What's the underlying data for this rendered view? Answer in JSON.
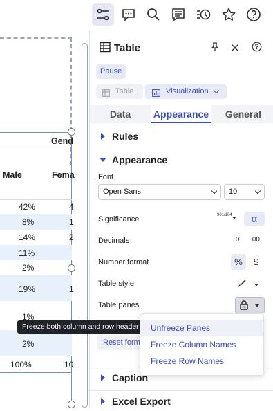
{
  "toolbar": {
    "icons": [
      "settings-sliders-icon",
      "comment-icon",
      "search-icon",
      "notes-icon",
      "history-icon",
      "star-icon",
      "help-icon"
    ]
  },
  "grid": {
    "group_header": "Gend",
    "col_headers": [
      "Male",
      "Fema"
    ],
    "rows": [
      {
        "male": "42%",
        "female": "4"
      },
      {
        "male": "8%",
        "female": "1"
      },
      {
        "male": "14%",
        "female": "2"
      },
      {
        "male": "11%",
        "female": ""
      },
      {
        "male": "2%",
        "female": ""
      },
      {
        "male": "19%",
        "female": "1"
      },
      {
        "male": "1%",
        "female": ""
      },
      {
        "male": "2%",
        "female": ""
      },
      {
        "male": "100%",
        "female": "10"
      }
    ]
  },
  "tooltip": "Freeze both column and row header",
  "panel": {
    "title": "Table",
    "pause_label": "Pause",
    "type_table": "Table",
    "type_visualization": "Visualization",
    "tabs": [
      "Data",
      "Appearance",
      "General"
    ],
    "active_tab": "Appearance",
    "sections": {
      "rules": "Rules",
      "appearance": "Appearance",
      "caption": "Caption",
      "excel_export": "Excel Export"
    },
    "font_label": "Font",
    "font_value": "Open Sans",
    "font_size": "10",
    "significance_label": "Significance",
    "significance_icon": "901/104",
    "alpha_symbol": "α",
    "decimals_label": "Decimals",
    "decimals_dec": ".0",
    "decimals_inc": ".00",
    "number_format_label": "Number format",
    "percent_symbol": "%",
    "dollar_symbol": "$",
    "table_style_label": "Table style",
    "table_panes_label": "Table panes",
    "reset_label": "Reset form"
  },
  "menu": {
    "items": [
      "Unfreeze Panes",
      "Freeze Column Names",
      "Freeze Row Names"
    ]
  },
  "colors": {
    "accent": "#3a4ec2",
    "active_tab_bg": "#e5e8f4",
    "row_band": "#e8f1fb"
  }
}
